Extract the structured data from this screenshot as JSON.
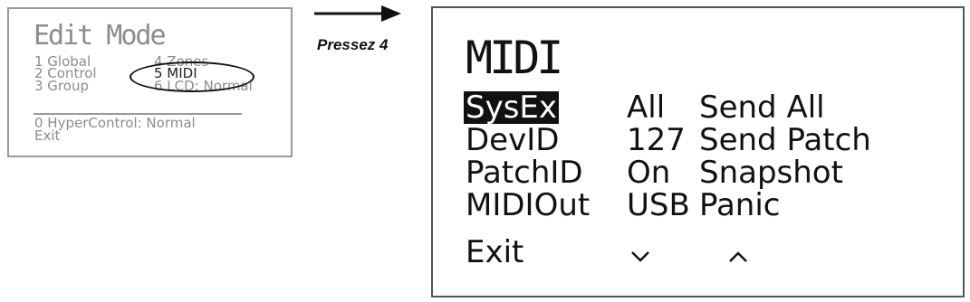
{
  "edit_mode_screen": {
    "title": "Edit Mode",
    "items": [
      {
        "label": "1 Global"
      },
      {
        "label": "2 Control"
      },
      {
        "label": "3 Group"
      },
      {
        "label": "4 Zones"
      },
      {
        "label": "5 MIDI"
      },
      {
        "label": "6 LCD: Normal"
      },
      {
        "label": "0 HyperControl: Normal"
      },
      {
        "label": "Exit"
      }
    ],
    "highlighted_item": "5 MIDI"
  },
  "transition": {
    "caption": "Pressez 4"
  },
  "midi_screen": {
    "title": "MIDI",
    "rows": [
      {
        "name": "SysEx",
        "value": "All",
        "action": "Send All",
        "selected": true
      },
      {
        "name": "DevID",
        "value": "127",
        "action": "Send Patch",
        "selected": false
      },
      {
        "name": "PatchID",
        "value": "On",
        "action": "Snapshot",
        "selected": false
      },
      {
        "name": "MIDIOut",
        "value": "USB",
        "action": "Panic",
        "selected": false
      }
    ],
    "footer": {
      "exit_label": "Exit",
      "down_icon": "chevron-down-icon",
      "up_icon": "chevron-up-icon"
    }
  },
  "colors": {
    "dim_text": "#8c8c8c",
    "lcd_text": "#111111",
    "selection_bg": "#111111",
    "selection_fg": "#ffffff"
  }
}
